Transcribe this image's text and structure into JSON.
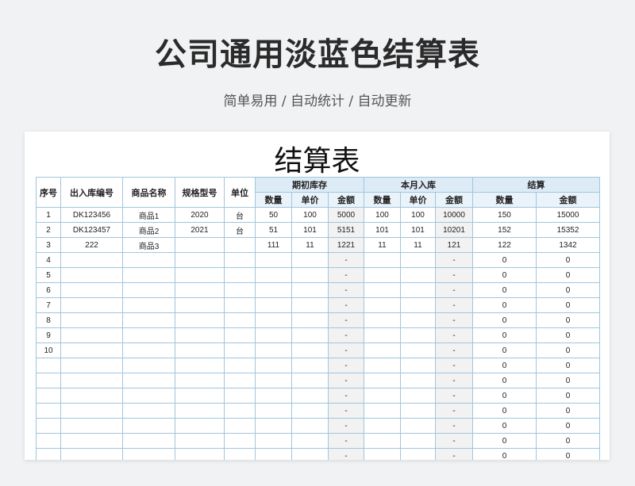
{
  "page": {
    "headline": "公司通用淡蓝色结算表",
    "subline": "简单易用 / 自动统计 / 自动更新"
  },
  "sheet": {
    "title": "结算表",
    "headers": {
      "seq": "序号",
      "code": "出入库编号",
      "name": "商品名称",
      "spec": "规格型号",
      "unit": "单位",
      "group_opening": "期初库存",
      "group_inbound": "本月入库",
      "group_settle": "结算",
      "qty": "数量",
      "price": "单价",
      "amount": "金额"
    },
    "rows": [
      {
        "seq": "1",
        "code": "DK123456",
        "name": "商品1",
        "spec": "2020",
        "unit": "台",
        "o_qty": "50",
        "o_price": "100",
        "o_amt": "5000",
        "i_qty": "100",
        "i_price": "100",
        "i_amt": "10000",
        "s_qty": "150",
        "s_amt": "15000"
      },
      {
        "seq": "2",
        "code": "DK123457",
        "name": "商品2",
        "spec": "2021",
        "unit": "台",
        "o_qty": "51",
        "o_price": "101",
        "o_amt": "5151",
        "i_qty": "101",
        "i_price": "101",
        "i_amt": "10201",
        "s_qty": "152",
        "s_amt": "15352"
      },
      {
        "seq": "3",
        "code": "222",
        "name": "商品3",
        "spec": "",
        "unit": "",
        "o_qty": "111",
        "o_price": "11",
        "o_amt": "1221",
        "i_qty": "11",
        "i_price": "11",
        "i_amt": "121",
        "s_qty": "122",
        "s_amt": "1342"
      },
      {
        "seq": "4",
        "code": "",
        "name": "",
        "spec": "",
        "unit": "",
        "o_qty": "",
        "o_price": "",
        "o_amt": "-",
        "i_qty": "",
        "i_price": "",
        "i_amt": "-",
        "s_qty": "0",
        "s_amt": "0"
      },
      {
        "seq": "5",
        "code": "",
        "name": "",
        "spec": "",
        "unit": "",
        "o_qty": "",
        "o_price": "",
        "o_amt": "-",
        "i_qty": "",
        "i_price": "",
        "i_amt": "-",
        "s_qty": "0",
        "s_amt": "0"
      },
      {
        "seq": "6",
        "code": "",
        "name": "",
        "spec": "",
        "unit": "",
        "o_qty": "",
        "o_price": "",
        "o_amt": "-",
        "i_qty": "",
        "i_price": "",
        "i_amt": "-",
        "s_qty": "0",
        "s_amt": "0"
      },
      {
        "seq": "7",
        "code": "",
        "name": "",
        "spec": "",
        "unit": "",
        "o_qty": "",
        "o_price": "",
        "o_amt": "-",
        "i_qty": "",
        "i_price": "",
        "i_amt": "-",
        "s_qty": "0",
        "s_amt": "0"
      },
      {
        "seq": "8",
        "code": "",
        "name": "",
        "spec": "",
        "unit": "",
        "o_qty": "",
        "o_price": "",
        "o_amt": "-",
        "i_qty": "",
        "i_price": "",
        "i_amt": "-",
        "s_qty": "0",
        "s_amt": "0"
      },
      {
        "seq": "9",
        "code": "",
        "name": "",
        "spec": "",
        "unit": "",
        "o_qty": "",
        "o_price": "",
        "o_amt": "-",
        "i_qty": "",
        "i_price": "",
        "i_amt": "-",
        "s_qty": "0",
        "s_amt": "0"
      },
      {
        "seq": "10",
        "code": "",
        "name": "",
        "spec": "",
        "unit": "",
        "o_qty": "",
        "o_price": "",
        "o_amt": "-",
        "i_qty": "",
        "i_price": "",
        "i_amt": "-",
        "s_qty": "0",
        "s_amt": "0"
      },
      {
        "seq": "",
        "code": "",
        "name": "",
        "spec": "",
        "unit": "",
        "o_qty": "",
        "o_price": "",
        "o_amt": "-",
        "i_qty": "",
        "i_price": "",
        "i_amt": "-",
        "s_qty": "0",
        "s_amt": "0"
      },
      {
        "seq": "",
        "code": "",
        "name": "",
        "spec": "",
        "unit": "",
        "o_qty": "",
        "o_price": "",
        "o_amt": "-",
        "i_qty": "",
        "i_price": "",
        "i_amt": "-",
        "s_qty": "0",
        "s_amt": "0"
      },
      {
        "seq": "",
        "code": "",
        "name": "",
        "spec": "",
        "unit": "",
        "o_qty": "",
        "o_price": "",
        "o_amt": "-",
        "i_qty": "",
        "i_price": "",
        "i_amt": "-",
        "s_qty": "0",
        "s_amt": "0"
      },
      {
        "seq": "",
        "code": "",
        "name": "",
        "spec": "",
        "unit": "",
        "o_qty": "",
        "o_price": "",
        "o_amt": "-",
        "i_qty": "",
        "i_price": "",
        "i_amt": "-",
        "s_qty": "0",
        "s_amt": "0"
      },
      {
        "seq": "",
        "code": "",
        "name": "",
        "spec": "",
        "unit": "",
        "o_qty": "",
        "o_price": "",
        "o_amt": "-",
        "i_qty": "",
        "i_price": "",
        "i_amt": "-",
        "s_qty": "0",
        "s_amt": "0"
      },
      {
        "seq": "",
        "code": "",
        "name": "",
        "spec": "",
        "unit": "",
        "o_qty": "",
        "o_price": "",
        "o_amt": "-",
        "i_qty": "",
        "i_price": "",
        "i_amt": "-",
        "s_qty": "0",
        "s_amt": "0"
      },
      {
        "seq": "",
        "code": "",
        "name": "",
        "spec": "",
        "unit": "",
        "o_qty": "",
        "o_price": "",
        "o_amt": "-",
        "i_qty": "",
        "i_price": "",
        "i_amt": "-",
        "s_qty": "0",
        "s_amt": "0"
      }
    ]
  }
}
